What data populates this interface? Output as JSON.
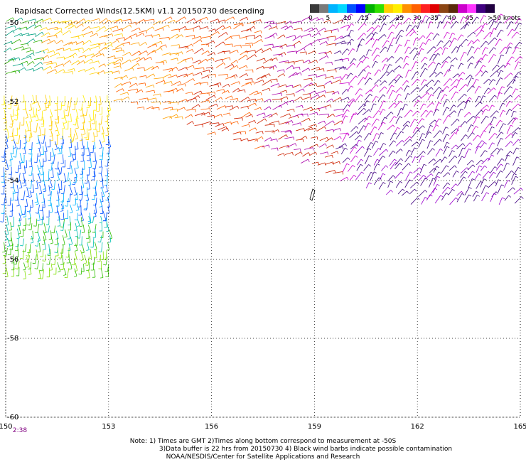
{
  "title": "Rapidsact Corrected Winds(12.5KM) v1.1 20150730 descending",
  "colorbar": {
    "ticks": [
      "0",
      "5",
      "10",
      "15",
      "20",
      "25",
      "30",
      "35",
      "40",
      "45"
    ],
    "units": ">50 knots",
    "colors": [
      "#3a3a3a",
      "#7a7a7a",
      "#00b4ff",
      "#00d8ff",
      "#0050ff",
      "#0000ff",
      "#00b000",
      "#30e000",
      "#ffd000",
      "#ffee00",
      "#ff9000",
      "#ff6000",
      "#ff2020",
      "#e00000",
      "#8b4513",
      "#5a2a0a",
      "#cc00cc",
      "#ff33ff",
      "#400080",
      "#200040"
    ]
  },
  "map": {
    "lon_ticks": [
      "150",
      "153",
      "156",
      "159",
      "162",
      "165"
    ],
    "lat_ticks": [
      "-50",
      "-52",
      "-54",
      "-56",
      "-58",
      "-60"
    ],
    "time_label": "2:38",
    "extent": {
      "lon": [
        150,
        165
      ],
      "lat": [
        -60,
        -50
      ]
    }
  },
  "notes": {
    "line1": "Note: 1) Times are GMT 2)Times along bottom correspond to measurement at -50S",
    "line2": "3)Data buffer is 22 hrs from 20150730 4) Black wind barbs indicate possible contamination",
    "line3": "NOAA/NESDIS/Center for Satellite Applications and Research"
  }
}
